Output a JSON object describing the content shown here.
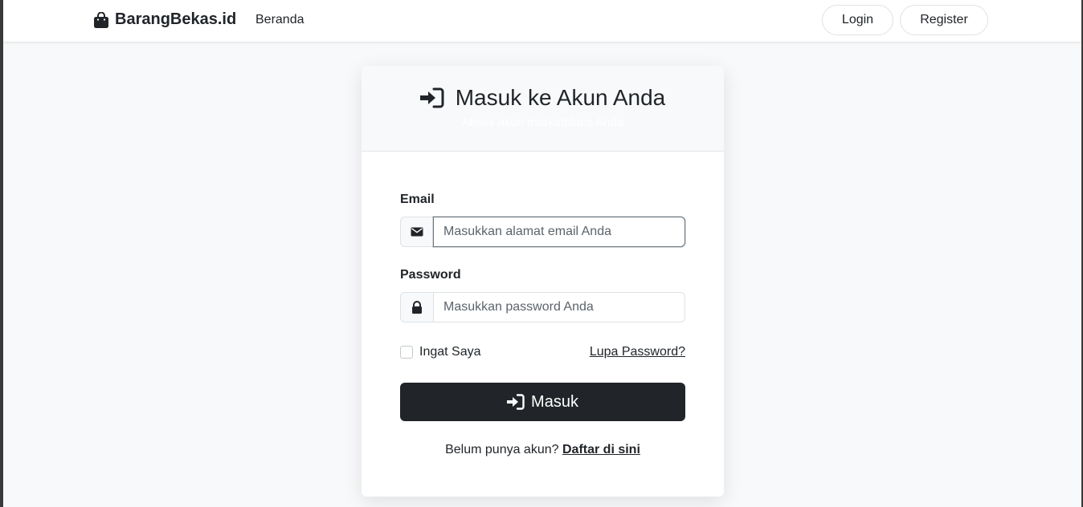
{
  "navbar": {
    "brand": "BarangBekas.id",
    "brand_icon": "shopping-bag-icon",
    "links": [
      "Beranda"
    ],
    "login_label": "Login",
    "register_label": "Register"
  },
  "card": {
    "title": "Masuk ke Akun Anda",
    "title_icon": "sign-in-icon",
    "subtitle": "Akses akun marketplace Anda"
  },
  "form": {
    "email_label": "Email",
    "email_icon": "envelope-icon",
    "email_placeholder": "Masukkan alamat email Anda",
    "email_value": "",
    "password_label": "Password",
    "password_icon": "lock-icon",
    "password_placeholder": "Masukkan password Anda",
    "password_value": "",
    "remember_label": "Ingat Saya",
    "remember_checked": false,
    "forgot_label": "Lupa Password?",
    "submit_label": "Masuk",
    "submit_icon": "sign-in-icon",
    "signup_prompt": "Belum punya akun?",
    "signup_link": "Daftar di sini"
  },
  "colors": {
    "primary_dark": "#212529",
    "page_bg": "#f8f9fa",
    "card_bg": "#ffffff"
  }
}
